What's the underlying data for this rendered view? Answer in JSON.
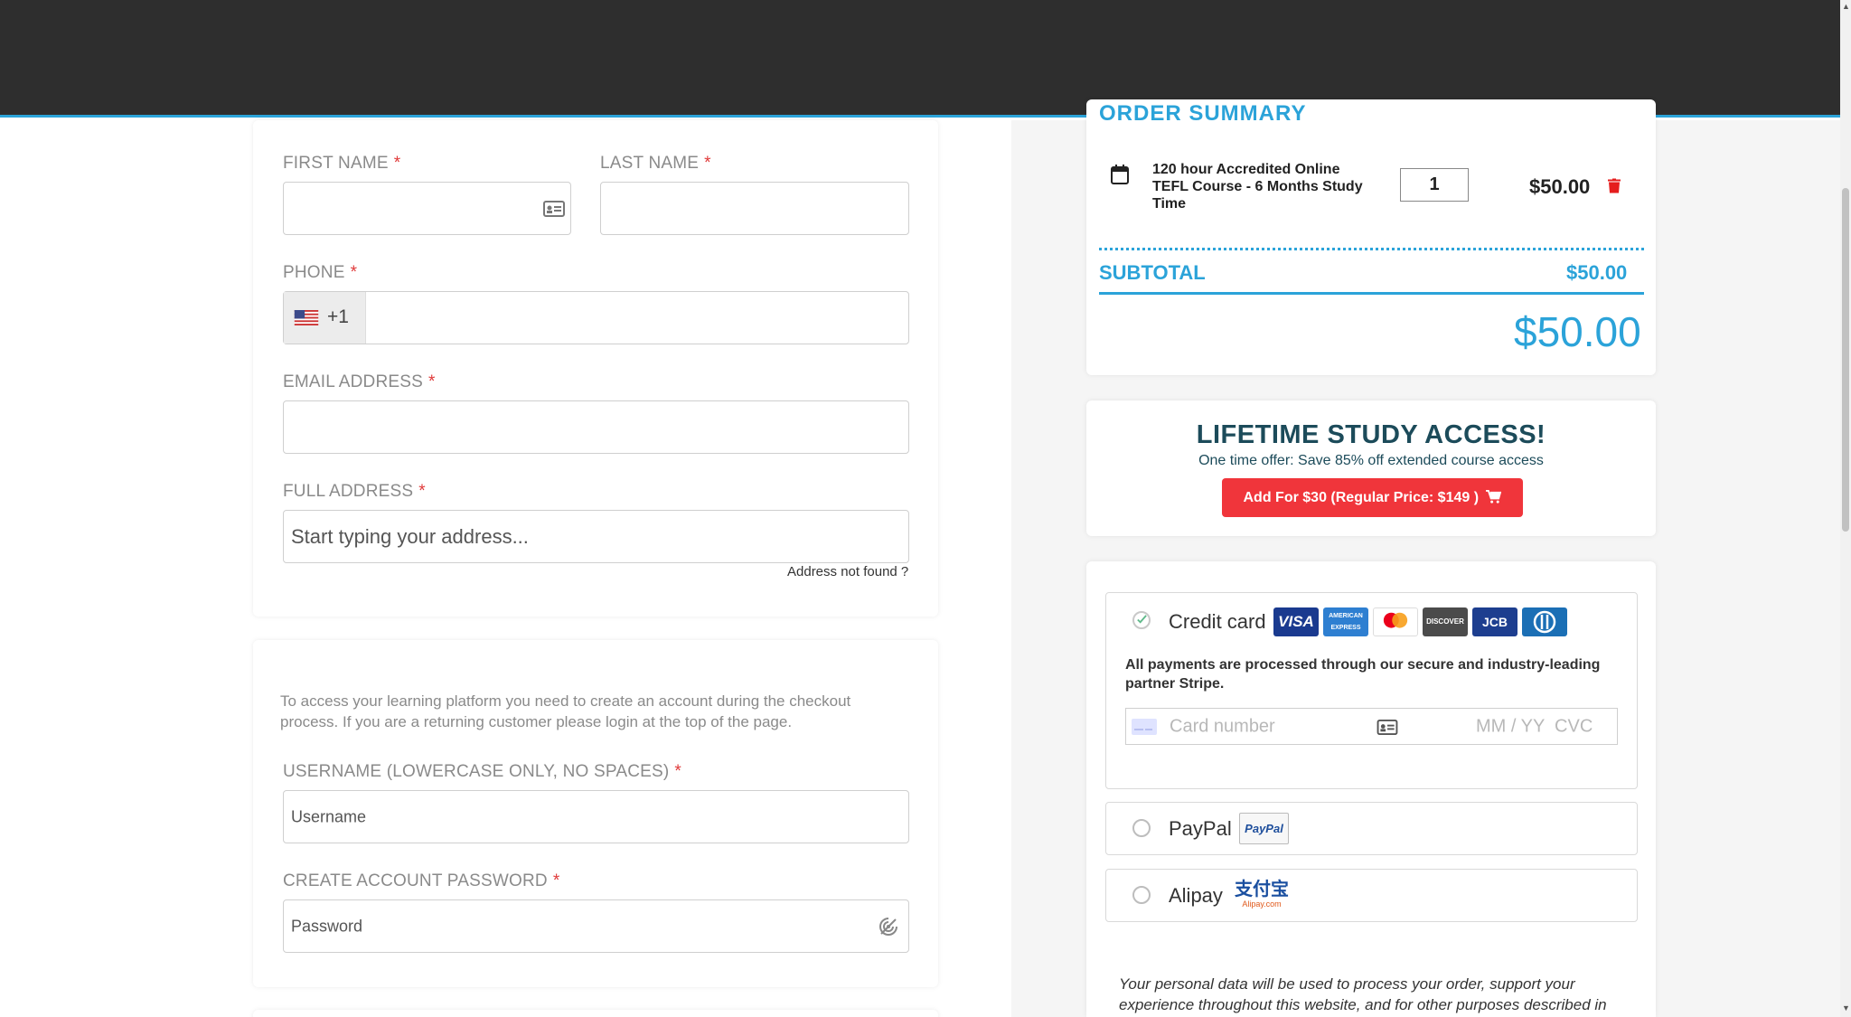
{
  "form": {
    "first_name": {
      "label": "FIRST NAME",
      "required": "*",
      "value": ""
    },
    "last_name": {
      "label": "LAST NAME",
      "required": "*",
      "value": ""
    },
    "phone": {
      "label": "PHONE",
      "required": "*",
      "country_code": "+1",
      "value": ""
    },
    "email": {
      "label": "EMAIL ADDRESS",
      "required": "*",
      "value": ""
    },
    "address": {
      "label": "FULL ADDRESS",
      "required": "*",
      "placeholder": "Start typing your address...",
      "not_found_link": "Address not found ?"
    }
  },
  "account": {
    "info": "To access your learning platform you need to create an account during the checkout process. If you are a returning customer please login at the top of the page.",
    "username": {
      "label": "USERNAME (LOWERCASE ONLY, NO SPACES)",
      "required": "*",
      "placeholder": "Username"
    },
    "password": {
      "label": "CREATE ACCOUNT PASSWORD",
      "required": "*",
      "placeholder": "Password"
    }
  },
  "order": {
    "item_name": "120 hour Accredited Online TEFL Course - 6 Months Study Time",
    "quantity": "1",
    "price": "$50.00",
    "subtotal_label": "SUBTOTAL",
    "subtotal_value": "$50.00",
    "total": "$50.00"
  },
  "promo": {
    "title": "LIFETIME STUDY ACCESS!",
    "subtitle": "One time offer: Save 85% off extended course access",
    "button": "Add For $30 (Regular Price: $149 )"
  },
  "payment": {
    "credit_card": {
      "label": "Credit card",
      "logos": [
        "VISA",
        "AMERICAN EXPRESS",
        "mastercard",
        "DISCOVER",
        "JCB",
        "Diners Club"
      ],
      "note": "All payments are processed through our secure and industry-leading partner Stripe.",
      "card_number_placeholder": "Card number",
      "expiry_cvc_placeholder": "MM / YY  CVC",
      "selected": true
    },
    "paypal": {
      "label": "PayPal",
      "logo_text": "PayPal"
    },
    "alipay": {
      "label": "Alipay",
      "logo_text": "支付宝",
      "logo_sub": "Alipay.com"
    }
  },
  "privacy": "Your personal data will be used to process your order, support your experience throughout this website, and for other purposes described in",
  "colors": {
    "accent": "#2ba3d9",
    "danger": "#f0353b",
    "dark_header": "#2e2e2e"
  }
}
